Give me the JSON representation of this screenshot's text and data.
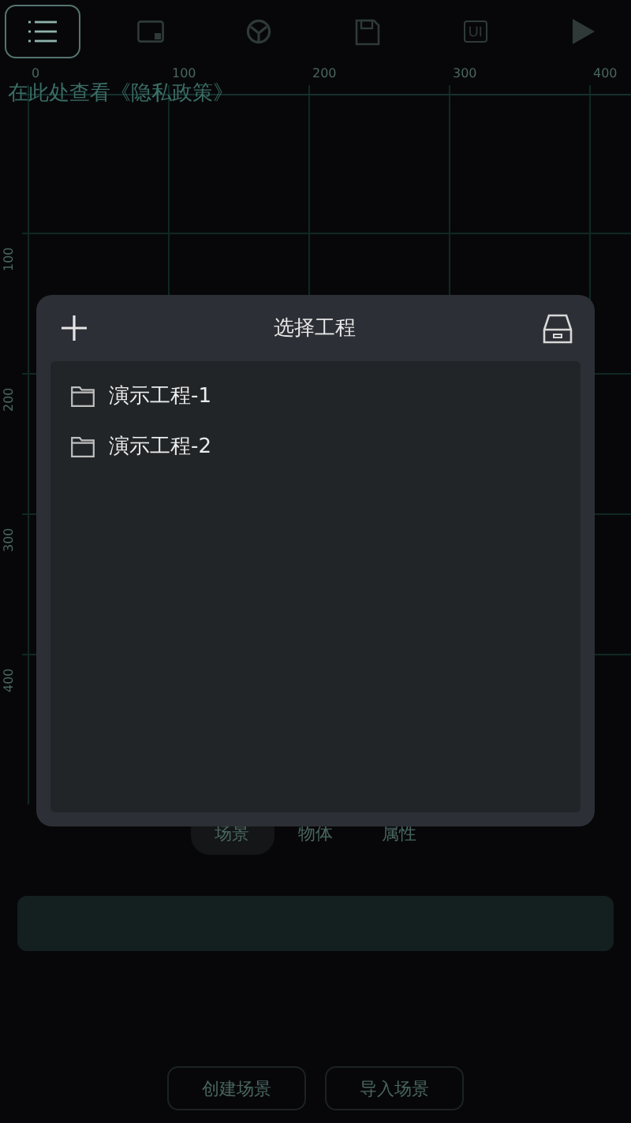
{
  "toolbar": [
    {
      "kind": "menu",
      "selected": true
    },
    {
      "kind": "frame",
      "selected": false
    },
    {
      "kind": "wheel",
      "selected": false
    },
    {
      "kind": "save",
      "selected": false
    },
    {
      "kind": "ui",
      "label": "UI",
      "selected": false
    },
    {
      "kind": "play",
      "selected": false
    }
  ],
  "privacy_link": "在此处查看《隐私政策》",
  "ruler": {
    "x_labels": [
      "0",
      "100",
      "200",
      "300",
      "400"
    ],
    "y_labels": [
      "100",
      "200",
      "300",
      "400"
    ]
  },
  "dialog": {
    "title": "选择工程",
    "projects": [
      {
        "name": "演示工程-1"
      },
      {
        "name": "演示工程-2"
      }
    ]
  },
  "tabs": [
    {
      "label": "场景",
      "selected": true
    },
    {
      "label": "物体",
      "selected": false
    },
    {
      "label": "属性",
      "selected": false
    }
  ],
  "buttons": [
    "创建场景",
    "导入场景"
  ]
}
